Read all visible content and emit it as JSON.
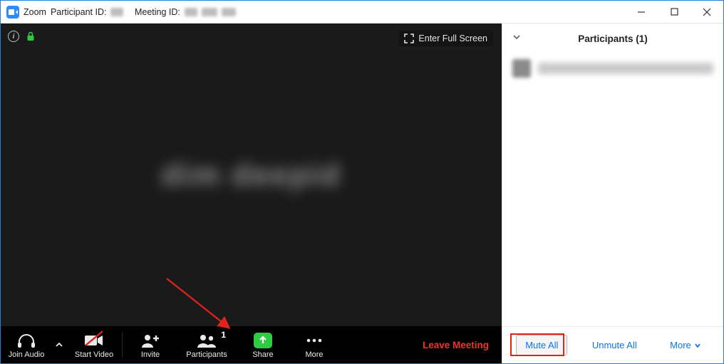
{
  "titlebar": {
    "app_prefix": "Zoom",
    "participant_id_label": "Participant ID:",
    "meeting_id_label": "Meeting ID:"
  },
  "video": {
    "fullscreen_label": "Enter Full Screen"
  },
  "controls": {
    "join_audio": "Join Audio",
    "start_video": "Start Video",
    "invite": "Invite",
    "participants": "Participants",
    "participants_count": "1",
    "share": "Share",
    "more": "More",
    "leave": "Leave Meeting"
  },
  "panel": {
    "title": "Participants (1)",
    "mute_all": "Mute All",
    "unmute_all": "Unmute All",
    "more": "More"
  }
}
